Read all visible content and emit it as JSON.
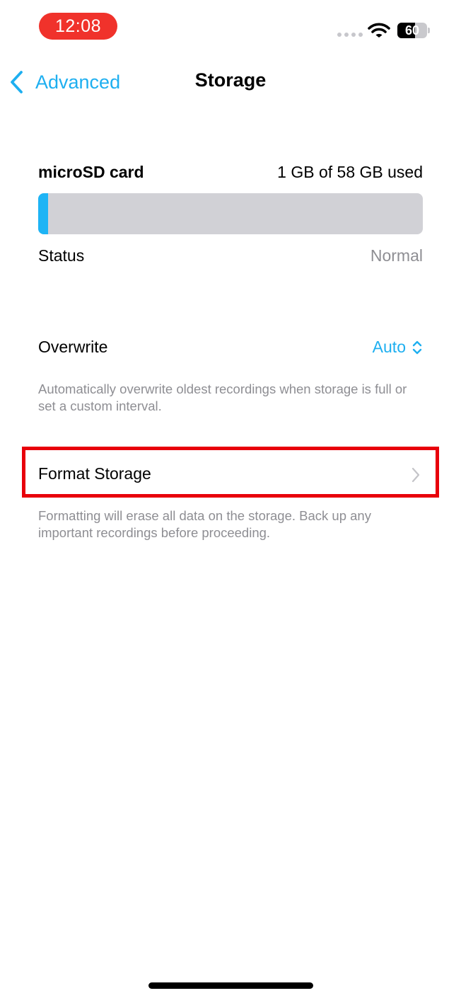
{
  "status_bar": {
    "time": "12:08",
    "battery_percent": 60,
    "battery_label": "60",
    "time_pill_color": "#f0322b"
  },
  "nav": {
    "back_label": "Advanced",
    "title": "Storage"
  },
  "storage": {
    "name": "microSD card",
    "usage_text": "1 GB of 58 GB used",
    "used_gb": 1,
    "total_gb": 58,
    "status_label": "Status",
    "status_value": "Normal"
  },
  "overwrite": {
    "label": "Overwrite",
    "value": "Auto",
    "help": "Automatically overwrite oldest recordings when storage is full or set a custom interval."
  },
  "format": {
    "label": "Format Storage",
    "help": "Formatting will erase all data on the storage. Back up any important recordings before proceeding."
  },
  "colors": {
    "accent": "#1eaff0",
    "bar_fill": "#1eb4f5",
    "bar_track": "#d1d1d6",
    "highlight_border": "#e8000b",
    "secondary_text": "#8e8e93"
  },
  "icons": {
    "back": "chevron-left-icon",
    "overwrite_picker": "chevron-up-down-icon",
    "format": "chevron-right-icon",
    "wifi": "wifi-icon"
  }
}
